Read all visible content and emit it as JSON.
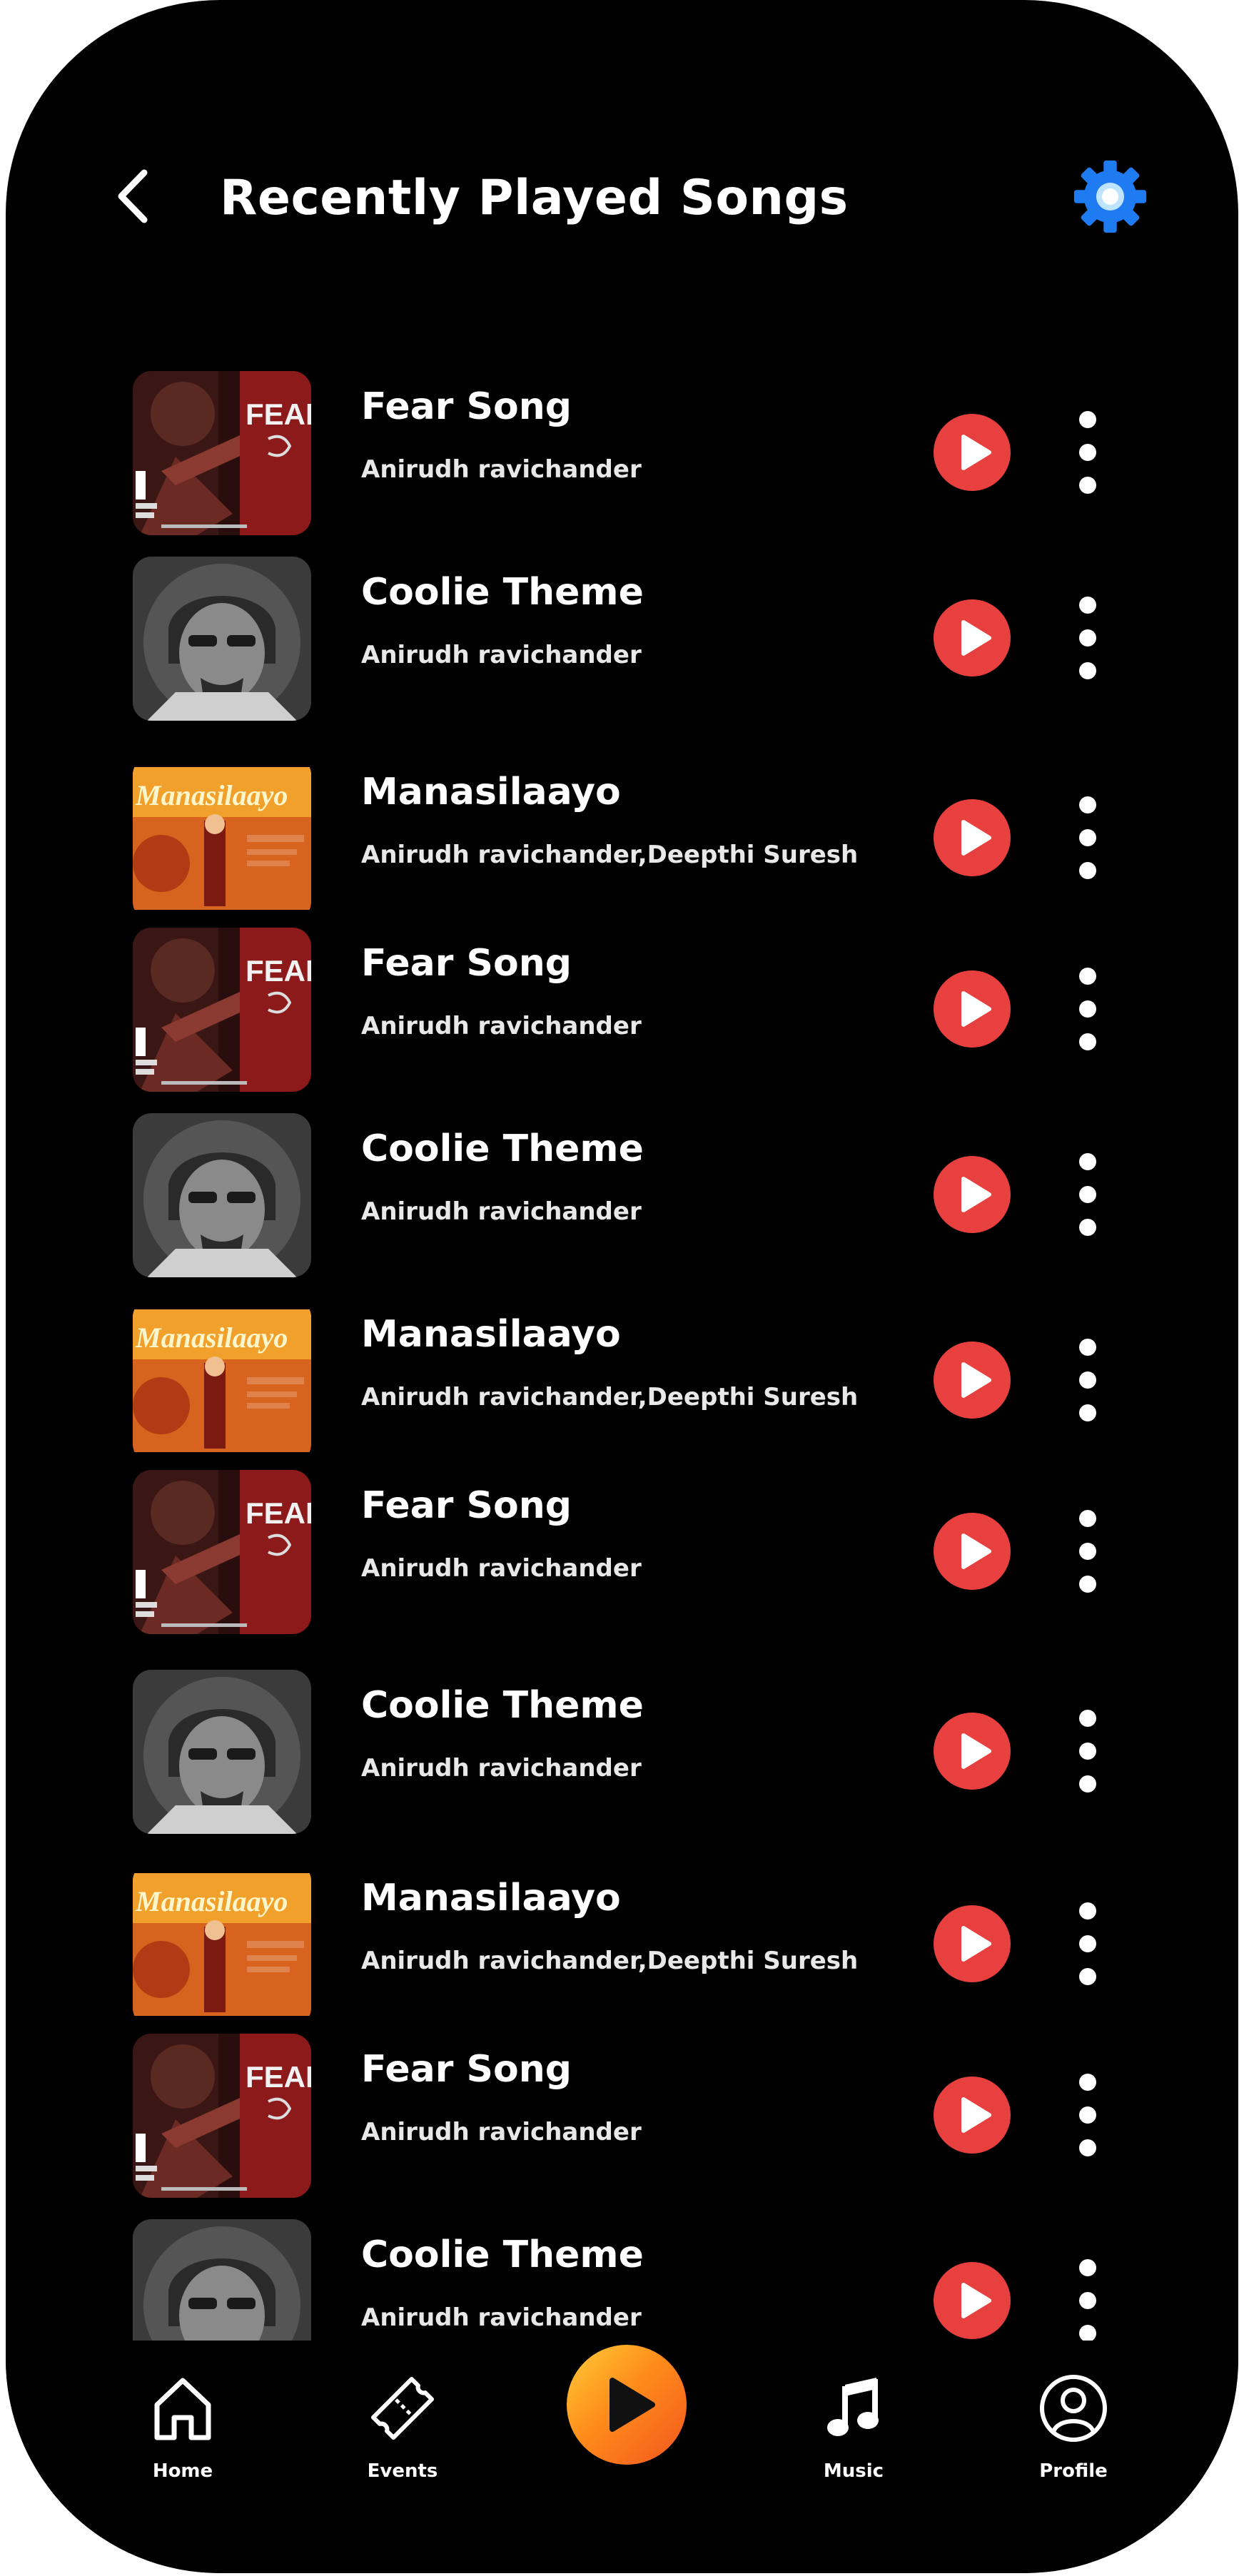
{
  "header": {
    "title": "Recently Played Songs"
  },
  "colors": {
    "background": "#000000",
    "play_button": "#e8403f",
    "gear": "#1e7bf2",
    "center_play_gradient": [
      "#ffcc3a",
      "#f2561f"
    ]
  },
  "songs": [
    {
      "title": "Fear Song",
      "artist": "Anirudh ravichander",
      "cover": "fear-song-cover"
    },
    {
      "title": "Coolie Theme",
      "artist": "Anirudh ravichander",
      "cover": "coolie-cover"
    },
    {
      "title": "Manasilaayo",
      "artist": "Anirudh ravichander,Deepthi Suresh",
      "cover": "manasilaayo-cover"
    },
    {
      "title": "Fear Song",
      "artist": "Anirudh ravichander",
      "cover": "fear-song-cover"
    },
    {
      "title": "Coolie Theme",
      "artist": "Anirudh ravichander",
      "cover": "coolie-cover"
    },
    {
      "title": "Manasilaayo",
      "artist": "Anirudh ravichander,Deepthi Suresh",
      "cover": "manasilaayo-cover"
    },
    {
      "title": "Fear Song",
      "artist": "Anirudh ravichander",
      "cover": "fear-song-cover"
    },
    {
      "title": "Coolie Theme",
      "artist": "Anirudh ravichander",
      "cover": "coolie-cover"
    },
    {
      "title": "Manasilaayo",
      "artist": "Anirudh ravichander,Deepthi Suresh",
      "cover": "manasilaayo-cover"
    },
    {
      "title": "Fear Song",
      "artist": "Anirudh ravichander",
      "cover": "fear-song-cover"
    },
    {
      "title": "Coolie Theme",
      "artist": "Anirudh ravichander",
      "cover": "coolie-cover"
    }
  ],
  "cover_text": {
    "fear": "FEAR S",
    "manasilaayo": "Manasilaayo"
  },
  "nav": {
    "home": "Home",
    "events": "Events",
    "music": "Music",
    "profile": "Profile"
  }
}
